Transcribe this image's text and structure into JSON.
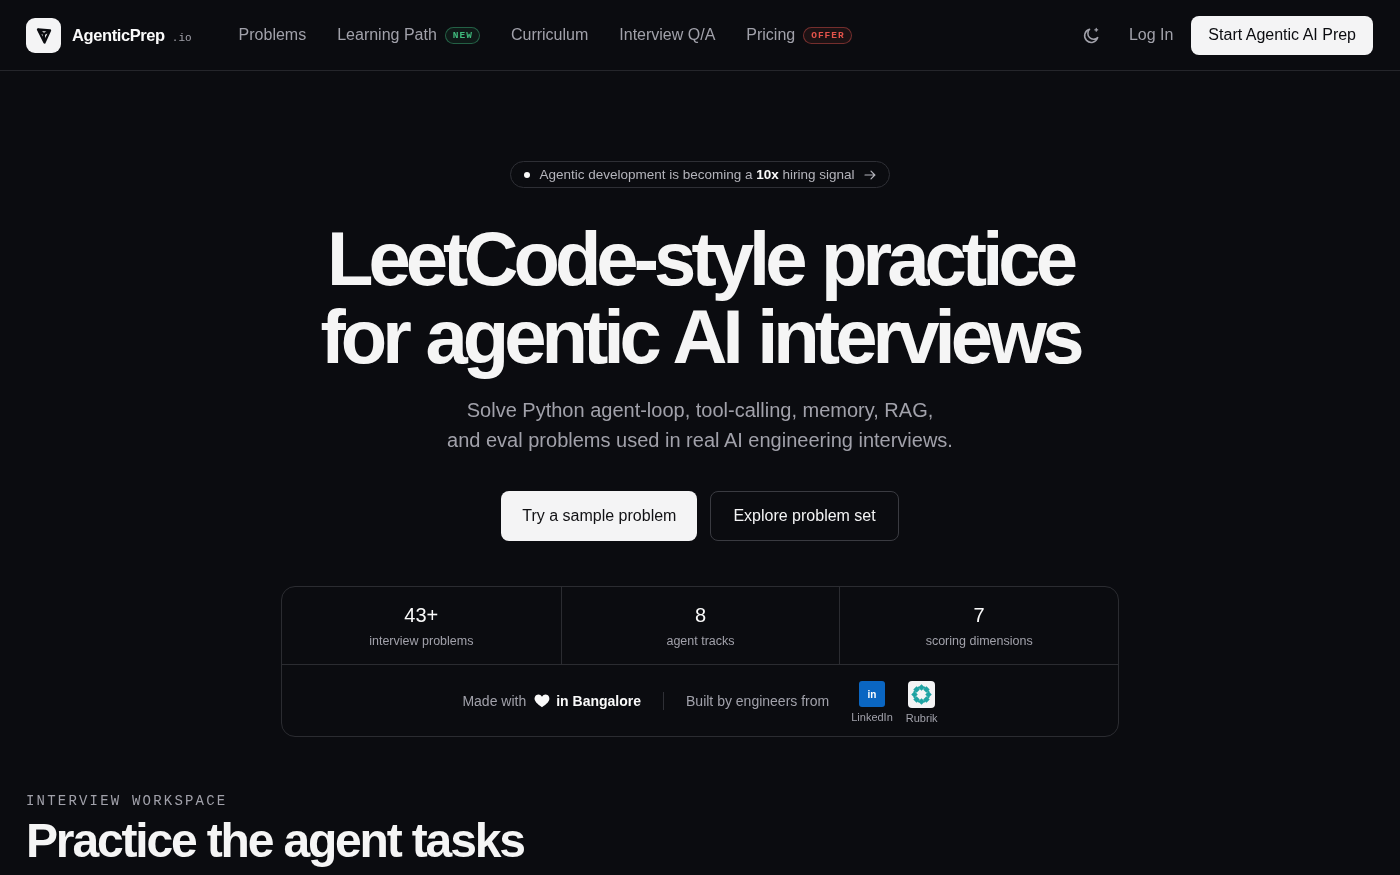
{
  "nav": {
    "brand": "AgenticPrep",
    "suffix": ".io",
    "links": [
      {
        "label": "Problems"
      },
      {
        "label": "Learning Path",
        "badge": {
          "text": "NEW",
          "color": "#3fb97c"
        }
      },
      {
        "label": "Curriculum"
      },
      {
        "label": "Interview Q/A"
      },
      {
        "label": "Pricing",
        "badge": {
          "text": "OFFER",
          "color": "#e5534b"
        }
      }
    ],
    "login": "Log In",
    "cta": "Start Agentic AI Prep"
  },
  "hero": {
    "announcement": "Agentic development is becoming a **10x** hiring signal",
    "headline": "LeetCode-style practice\nfor agentic AI interviews",
    "subtitle": "Solve Python agent-loop, tool-calling, memory, RAG,\nand eval problems used in real AI engineering interviews.",
    "buttons": [
      {
        "label": "Try a sample problem",
        "kind": "primary"
      },
      {
        "label": "Explore problem set",
        "kind": "secondary"
      }
    ]
  },
  "stats": {
    "items": [
      {
        "value": "43+",
        "label": "interview problems"
      },
      {
        "value": "8",
        "label": "agent tracks"
      },
      {
        "value": "7",
        "label": "scoring dimensions"
      }
    ],
    "made_with": "Made with",
    "location": "in Bangalore",
    "built_by": "Built by engineers from",
    "companies": [
      {
        "name": "LinkedIn",
        "kind": "letters",
        "logo_text": "in"
      },
      {
        "name": "Rubrik",
        "kind": "ring"
      }
    ]
  },
  "section": {
    "eyebrow": "INTERVIEW WORKSPACE",
    "heading": "Practice the agent tasks"
  }
}
